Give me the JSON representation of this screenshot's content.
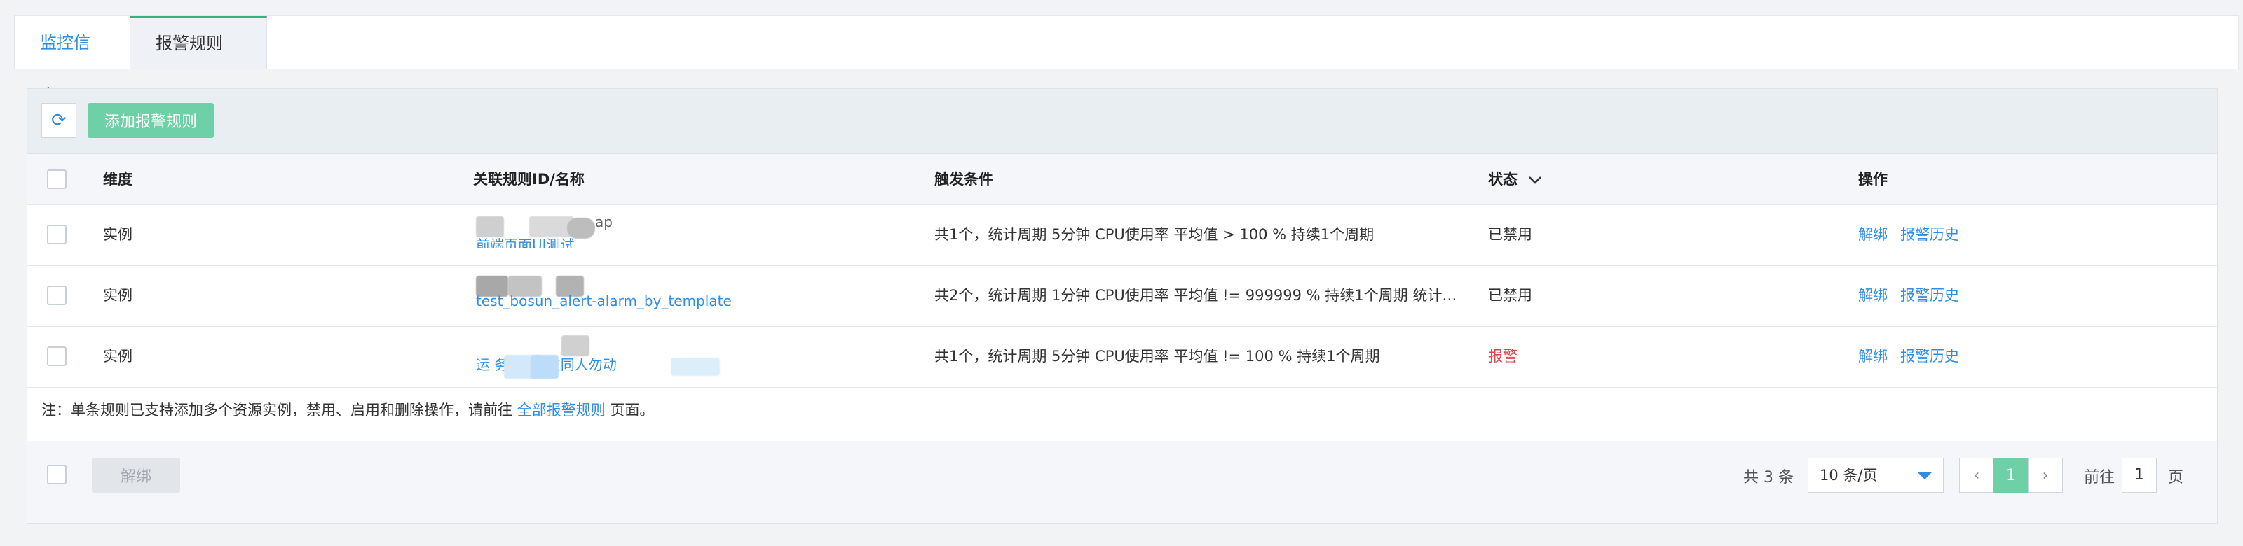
{
  "tabs": [
    {
      "label": "监控信息",
      "active": false
    },
    {
      "label": "报警规则",
      "active": true
    }
  ],
  "toolbar": {
    "refresh_icon": "refresh-icon",
    "add_label": "添加报警规则"
  },
  "table": {
    "headers": [
      "维度",
      "关联规则ID/名称",
      "触发条件",
      "状态",
      "操作"
    ],
    "status_sort_icon": "chevron-down-icon",
    "rows": [
      {
        "dimension": "实例",
        "rule_top": "ap",
        "rule_name": "前端页面UI测试",
        "condition": "共1个，统计周期 5分钟 CPU使用率 平均值 > 100 % 持续1个周期",
        "status": "已禁用",
        "status_color": "#333333",
        "actions": [
          "解绑",
          "报警历史"
        ]
      },
      {
        "dimension": "实例",
        "rule_top": "",
        "rule_name": "test_bosun_alert-alarm_by_template",
        "condition": "共2个，统计周期 1分钟 CPU使用率 平均值 != 999999 % 持续1个周期 统计…",
        "status": "已禁用",
        "status_color": "#333333",
        "actions": [
          "解绑",
          "报警历史"
        ]
      },
      {
        "dimension": "实例",
        "rule_top": "",
        "rule_name": "运 务监控--在同人勿动",
        "condition": "共1个，统计周期 5分钟 CPU使用率 平均值 != 100 % 持续1个周期",
        "status": "报警",
        "status_color": "#e0454a",
        "actions": [
          "解绑",
          "报警历史"
        ]
      }
    ]
  },
  "note": {
    "prefix": "注：单条规则已支持添加多个资源实例，禁用、启用和删除操作，请前往",
    "link": "全部报警规则",
    "suffix": "页面。"
  },
  "footer": {
    "unbind_label": "解绑",
    "total_text": "共 3 条",
    "page_size": "10 条/页",
    "prev": "‹",
    "current_page": "1",
    "next": "›",
    "goto_label": "前往",
    "goto_value": "1",
    "page_label": "页"
  },
  "colors": {
    "accent": "#2f8ee3",
    "primary_green": "#6ed0a7",
    "alarm_red": "#e0454a"
  }
}
